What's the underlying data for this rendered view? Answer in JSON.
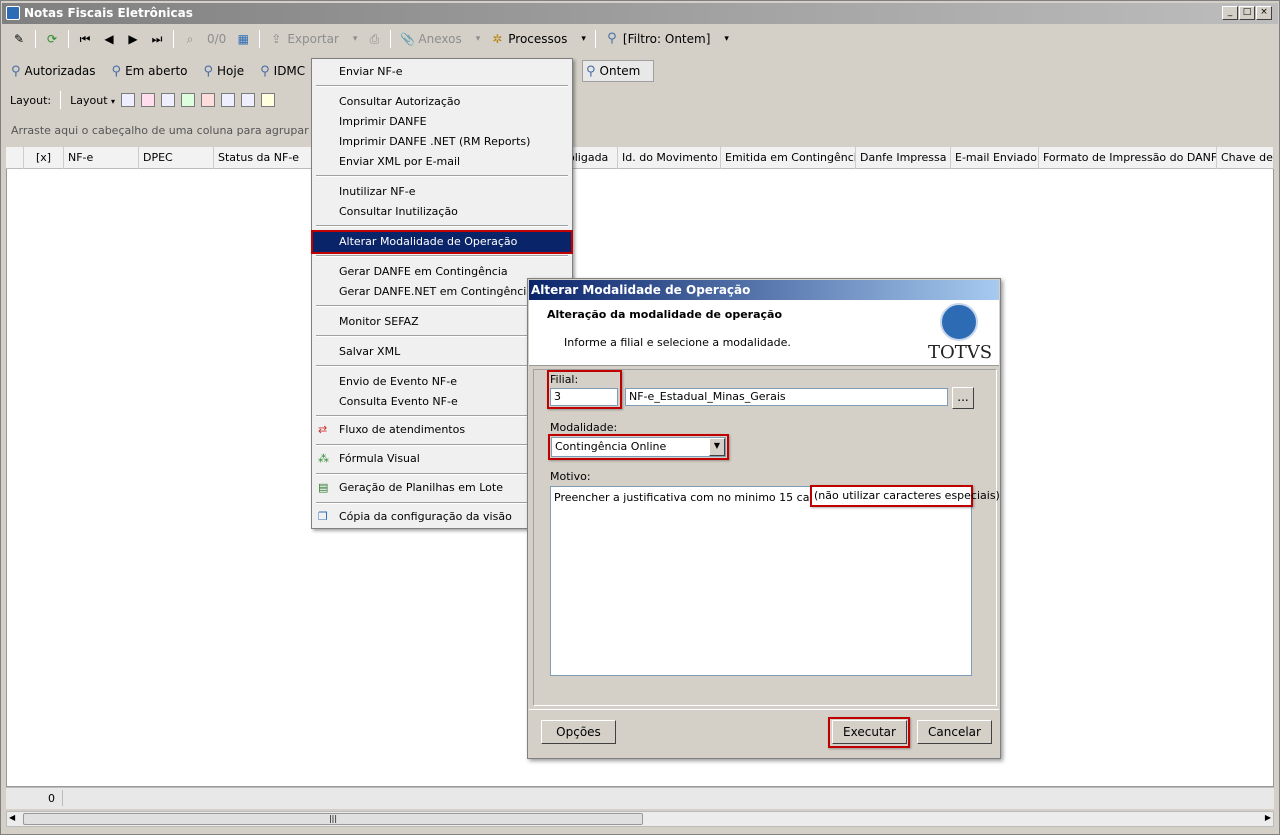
{
  "window": {
    "title": "Notas Fiscais Eletrônicas"
  },
  "toolbar": {
    "record_counter": "0/0",
    "export_label": "Exportar",
    "attachments_label": "Anexos",
    "processes_label": "Processos",
    "filter_label": "[Filtro: Ontem]"
  },
  "filters": {
    "items": [
      "Autorizadas",
      "Em aberto",
      "Hoje",
      "IDMC"
    ],
    "active": "Ontem"
  },
  "layoutbar": {
    "label": "Layout:",
    "layout_dropdown": "Layout"
  },
  "grid": {
    "group_hint": "Arraste aqui o cabeçalho de uma coluna para agrupar",
    "columns": [
      "[x]",
      "NF-e",
      "DPEC",
      "Status da NF-e",
      "oligada",
      "Id. do Movimento",
      "Emitida em Contingência",
      "Danfe Impressa",
      "E-mail Enviado",
      "Formato de Impressão do DANFE",
      "Chave de A"
    ],
    "footer_count": "0"
  },
  "menu": {
    "items": [
      "Enviar NF-e",
      "Consultar Autorização",
      "Imprimir DANFE",
      "Imprimir DANFE .NET (RM Reports)",
      "Enviar XML por E-mail",
      "Inutilizar NF-e",
      "Consultar Inutilização",
      "Alterar Modalidade de Operação",
      "Gerar DANFE em Contingência",
      "Gerar DANFE.NET em Contingência",
      "Monitor SEFAZ",
      "Salvar XML",
      "Envio de Evento NF-e",
      "Consulta Evento NF-e",
      "Fluxo de atendimentos",
      "Fórmula Visual",
      "Geração de Planilhas em Lote",
      "Cópia da configuração da visão"
    ]
  },
  "dialog": {
    "title": "Alterar Modalidade de Operação",
    "heading": "Alteração da modalidade de operação",
    "subheading": "Informe a filial e selecione a modalidade.",
    "logo_text": "TOTVS",
    "filial_label": "Filial:",
    "filial_value": "3",
    "filial_name": "NF-e_Estadual_Minas_Gerais",
    "lookup_label": "...",
    "modalidade_label": "Modalidade:",
    "modalidade_value": "Contingência Online",
    "motivo_label": "Motivo:",
    "motivo_text": "Preencher a justificativa com no minimo 15 caracteres ",
    "motivo_note": "(não utilizar caracteres especiais)",
    "options_button": "Opções",
    "execute_button": "Executar",
    "cancel_button": "Cancelar"
  }
}
